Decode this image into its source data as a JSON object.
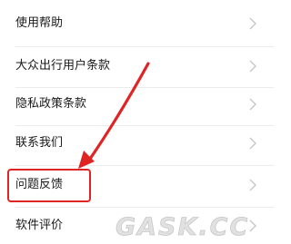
{
  "menu": {
    "items": [
      {
        "label": "使用帮助"
      },
      {
        "label": "大众出行用户条款"
      },
      {
        "label": "隐私政策条款"
      },
      {
        "label": "联系我们"
      },
      {
        "label": "问题反馈"
      },
      {
        "label": "软件评价"
      }
    ]
  },
  "annotation": {
    "highlight_color": "#e02424",
    "highlighted_item": "问题反馈"
  },
  "watermark": {
    "text": "GASK.CC"
  },
  "icons": {
    "chevron": "chevron-right-icon"
  }
}
